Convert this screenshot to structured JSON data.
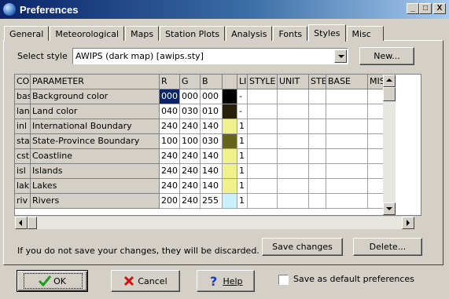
{
  "window": {
    "title": "Preferences",
    "controls": {
      "minimize": "_",
      "maximize": "□",
      "close": "X"
    }
  },
  "tabs": [
    "General",
    "Meteorological",
    "Maps",
    "Station Plots",
    "Analysis",
    "Fonts",
    "Styles",
    "Misc"
  ],
  "active_tab": "Styles",
  "select_style": {
    "label": "Select style",
    "value": "AWIPS (dark map) [awips.sty]",
    "new_button": "New..."
  },
  "table": {
    "headers": [
      "CODE",
      "PARAMETER",
      "R",
      "G",
      "B",
      "",
      "LIN",
      "STYLE",
      "UNIT",
      "STE",
      "BASE",
      "MISC"
    ],
    "rows": [
      {
        "code": "bas",
        "parameter": "Background color",
        "r": "000",
        "g": "000",
        "b": "000",
        "swatch": "#000000",
        "lin": "-"
      },
      {
        "code": "lan",
        "parameter": "Land color",
        "r": "040",
        "g": "030",
        "b": "010",
        "swatch": "#28200a",
        "lin": "-"
      },
      {
        "code": "inl",
        "parameter": "International Boundary",
        "r": "240",
        "g": "240",
        "b": "140",
        "swatch": "#f0f08c",
        "lin": "1"
      },
      {
        "code": "sta",
        "parameter": "State-Province Boundary",
        "r": "100",
        "g": "100",
        "b": "030",
        "swatch": "#64641e",
        "lin": "1"
      },
      {
        "code": "cst",
        "parameter": "Coastline",
        "r": "240",
        "g": "240",
        "b": "140",
        "swatch": "#f0f08c",
        "lin": "1"
      },
      {
        "code": "isl",
        "parameter": "Islands",
        "r": "240",
        "g": "240",
        "b": "140",
        "swatch": "#f0f08c",
        "lin": "1"
      },
      {
        "code": "lak",
        "parameter": "Lakes",
        "r": "240",
        "g": "240",
        "b": "140",
        "swatch": "#f0f08c",
        "lin": "1"
      },
      {
        "code": "riv",
        "parameter": "Rivers",
        "r": "200",
        "g": "240",
        "b": "255",
        "swatch": "#c8f0ff",
        "lin": "1"
      }
    ],
    "selection_color": "#0a246a"
  },
  "footer": {
    "discard_note": "If you do not save your changes, they will be discarded.",
    "save_changes": "Save changes",
    "delete": "Delete..."
  },
  "bottom": {
    "ok": "OK",
    "cancel": "Cancel",
    "help": "Help",
    "default_label": "Save as default preferences",
    "default_checked": false
  },
  "icons": {
    "ok": "green-check-icon",
    "cancel": "red-x-icon",
    "help": "blue-question-icon",
    "app": "globe-icon"
  }
}
